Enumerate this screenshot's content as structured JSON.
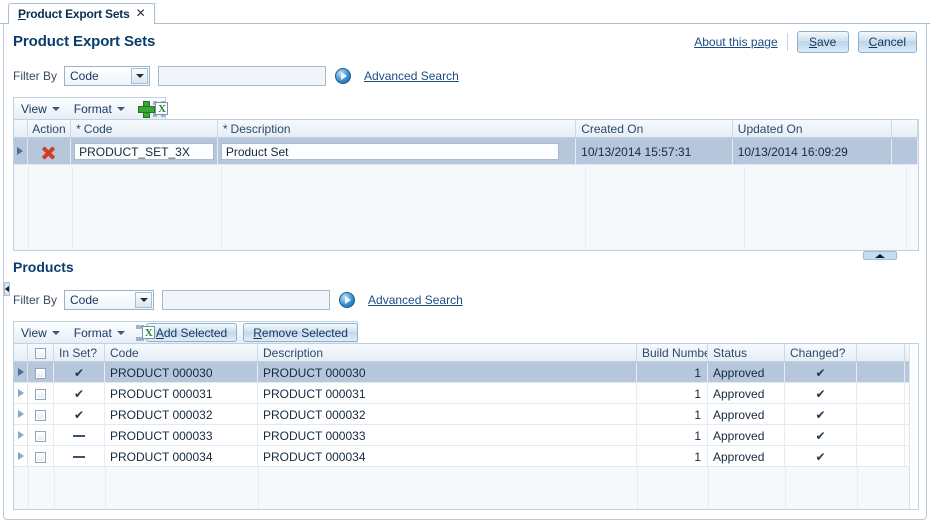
{
  "tab": {
    "label": "Product Export Sets",
    "accel": "P",
    "close_icon": "close-icon"
  },
  "header": {
    "title": "Product Export Sets",
    "about_link": "About this page",
    "about_accel": "A",
    "save_label": "Save",
    "save_accel": "S",
    "cancel_label": "Cancel",
    "cancel_accel": "C"
  },
  "sets_filter": {
    "label": "Filter By",
    "select_value": "Code",
    "search_value": "",
    "search_placeholder": "",
    "go_icon": "search-go-icon",
    "advanced_search": "Advanced Search",
    "advanced_accel": "A"
  },
  "sets_toolbar": {
    "view_label": "View",
    "format_label": "Format",
    "add_icon": "add-row-icon",
    "export_icon": "export-to-excel-icon"
  },
  "sets_grid": {
    "columns": [
      {
        "label": "Action",
        "required": false
      },
      {
        "label": "Code",
        "required": true
      },
      {
        "label": "Description",
        "required": true
      },
      {
        "label": "Created On",
        "required": false
      },
      {
        "label": "Updated On",
        "required": false
      }
    ],
    "rows": [
      {
        "action_icon": "delete-row-icon",
        "code": "PRODUCT_SET_3X",
        "description": "Product Set",
        "created_on": "10/13/2014 15:57:31",
        "updated_on": "10/13/2014 16:09:29",
        "selected": true
      }
    ]
  },
  "products_section": {
    "title": "Products"
  },
  "products_filter": {
    "label": "Filter By",
    "select_value": "Code",
    "search_value": "",
    "search_placeholder": "",
    "go_icon": "search-go-icon",
    "advanced_search": "Advanced Search",
    "advanced_accel": "A"
  },
  "products_toolbar": {
    "view_label": "View",
    "format_label": "Format",
    "export_icon": "export-to-excel-icon",
    "add_selected_label": "Add Selected",
    "add_selected_accel": "A",
    "remove_selected_label": "Remove Selected",
    "remove_selected_accel": "R"
  },
  "products_grid": {
    "columns": [
      {
        "label": "",
        "kind": "select-all-checkbox"
      },
      {
        "label": "In Set?",
        "kind": "text"
      },
      {
        "label": "Code",
        "kind": "text"
      },
      {
        "label": "Description",
        "kind": "text"
      },
      {
        "label": "Build Number",
        "kind": "number"
      },
      {
        "label": "Status",
        "kind": "text"
      },
      {
        "label": "Changed?",
        "kind": "text"
      },
      {
        "label": "",
        "kind": "text"
      }
    ],
    "rows": [
      {
        "checked": false,
        "in_set": "check",
        "code": "PRODUCT 000030",
        "description": "PRODUCT 000030",
        "build_number": "1",
        "status": "Approved",
        "changed": "check",
        "selected": true
      },
      {
        "checked": false,
        "in_set": "check",
        "code": "PRODUCT 000031",
        "description": "PRODUCT 000031",
        "build_number": "1",
        "status": "Approved",
        "changed": "check",
        "selected": false
      },
      {
        "checked": false,
        "in_set": "check",
        "code": "PRODUCT 000032",
        "description": "PRODUCT 000032",
        "build_number": "1",
        "status": "Approved",
        "changed": "check",
        "selected": false
      },
      {
        "checked": false,
        "in_set": "dash",
        "code": "PRODUCT 000033",
        "description": "PRODUCT 000033",
        "build_number": "1",
        "status": "Approved",
        "changed": "check",
        "selected": false
      },
      {
        "checked": false,
        "in_set": "dash",
        "code": "PRODUCT 000034",
        "description": "PRODUCT 000034",
        "build_number": "1",
        "status": "Approved",
        "changed": "check",
        "selected": false
      }
    ]
  },
  "splitter": {
    "collapse_icon": "collapse-up-icon",
    "left_collapse_icon": "collapse-left-icon"
  },
  "colors": {
    "accent": "#0b3c6e",
    "selection": "#b6c7dc",
    "grid_header": "#e6edf5",
    "delete_icon": "#d63b28",
    "add_icon": "#3aa63a",
    "link": "#1a4d84"
  }
}
